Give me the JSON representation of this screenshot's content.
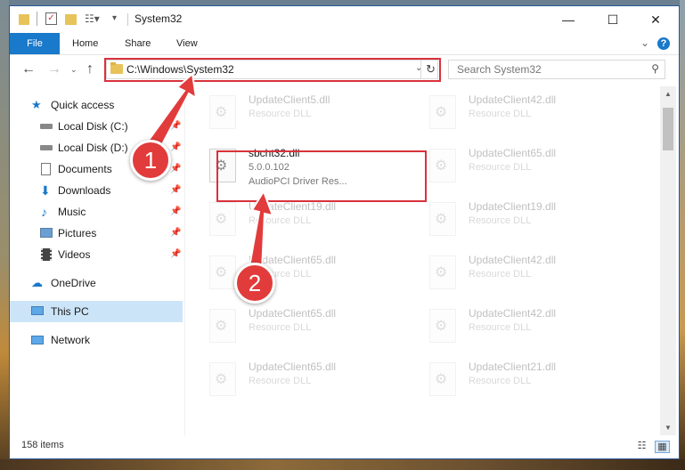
{
  "window": {
    "title": "System32"
  },
  "window_controls": {
    "minimize": "—",
    "maximize": "☐",
    "close": "✕"
  },
  "ribbon": {
    "tabs": [
      "File",
      "Home",
      "Share",
      "View"
    ]
  },
  "address_bar": {
    "path": "C:\\Windows\\System32"
  },
  "search": {
    "placeholder": "Search System32"
  },
  "navigation_pane": {
    "items": [
      {
        "label": "Quick access",
        "icon": "star-icon",
        "pinned": false
      },
      {
        "label": "Local Disk (C:)",
        "icon": "drive-icon",
        "pinned": true
      },
      {
        "label": "Local Disk (D:)",
        "icon": "drive-icon",
        "pinned": true
      },
      {
        "label": "Documents",
        "icon": "documents-icon",
        "pinned": true
      },
      {
        "label": "Downloads",
        "icon": "download-icon",
        "pinned": true
      },
      {
        "label": "Music",
        "icon": "music-icon",
        "pinned": true
      },
      {
        "label": "Pictures",
        "icon": "pictures-icon",
        "pinned": true
      },
      {
        "label": "Videos",
        "icon": "videos-icon",
        "pinned": true
      },
      {
        "label": "OneDrive",
        "icon": "cloud-icon",
        "pinned": false
      },
      {
        "label": "This PC",
        "icon": "computer-icon",
        "pinned": false,
        "selected": true
      },
      {
        "label": "Network",
        "icon": "network-icon",
        "pinned": false
      }
    ]
  },
  "files": {
    "left": [
      {
        "name": "UpdateClient5.dll",
        "line2": "Resource DLL",
        "line3": "",
        "faded": true
      },
      {
        "name": "sbcht32.dll",
        "line2": "5.0.0.102",
        "line3": "AudioPCI Driver Res...",
        "faded": false
      },
      {
        "name": "UpdateClient19.dll",
        "line2": "Resource DLL",
        "line3": "",
        "faded": true
      },
      {
        "name": "UpdateClient65.dll",
        "line2": "Resource DLL",
        "line3": "",
        "faded": true
      },
      {
        "name": "UpdateClient65.dll",
        "line2": "Resource DLL",
        "line3": "",
        "faded": true
      },
      {
        "name": "UpdateClient65.dll",
        "line2": "Resource DLL",
        "line3": "",
        "faded": true
      }
    ],
    "right": [
      {
        "name": "UpdateClient42.dll",
        "line2": "Resource DLL",
        "faded": true
      },
      {
        "name": "UpdateClient65.dll",
        "line2": "Resource DLL",
        "faded": true
      },
      {
        "name": "UpdateClient19.dll",
        "line2": "Resource DLL",
        "faded": true
      },
      {
        "name": "UpdateClient42.dll",
        "line2": "Resource DLL",
        "faded": true
      },
      {
        "name": "UpdateClient42.dll",
        "line2": "Resource DLL",
        "faded": true
      },
      {
        "name": "UpdateClient21.dll",
        "line2": "Resource DLL",
        "faded": true
      }
    ]
  },
  "status": {
    "item_count": "158 items"
  },
  "callouts": [
    {
      "number": "1",
      "target": "address-bar"
    },
    {
      "number": "2",
      "target": "sbcht32.dll"
    }
  ],
  "colors": {
    "accent": "#1979ca",
    "highlight": "#d9323c",
    "selected": "#cce4f7"
  }
}
